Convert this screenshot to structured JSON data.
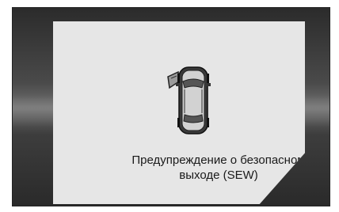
{
  "warning": {
    "line1": "Предупреждение о безопасном",
    "line2": "выходе (SEW)"
  },
  "icon": "car-open-door-icon",
  "colors": {
    "panel": "#e6e6e6",
    "background": "#2b2b2b",
    "text": "#1a1a1a"
  }
}
